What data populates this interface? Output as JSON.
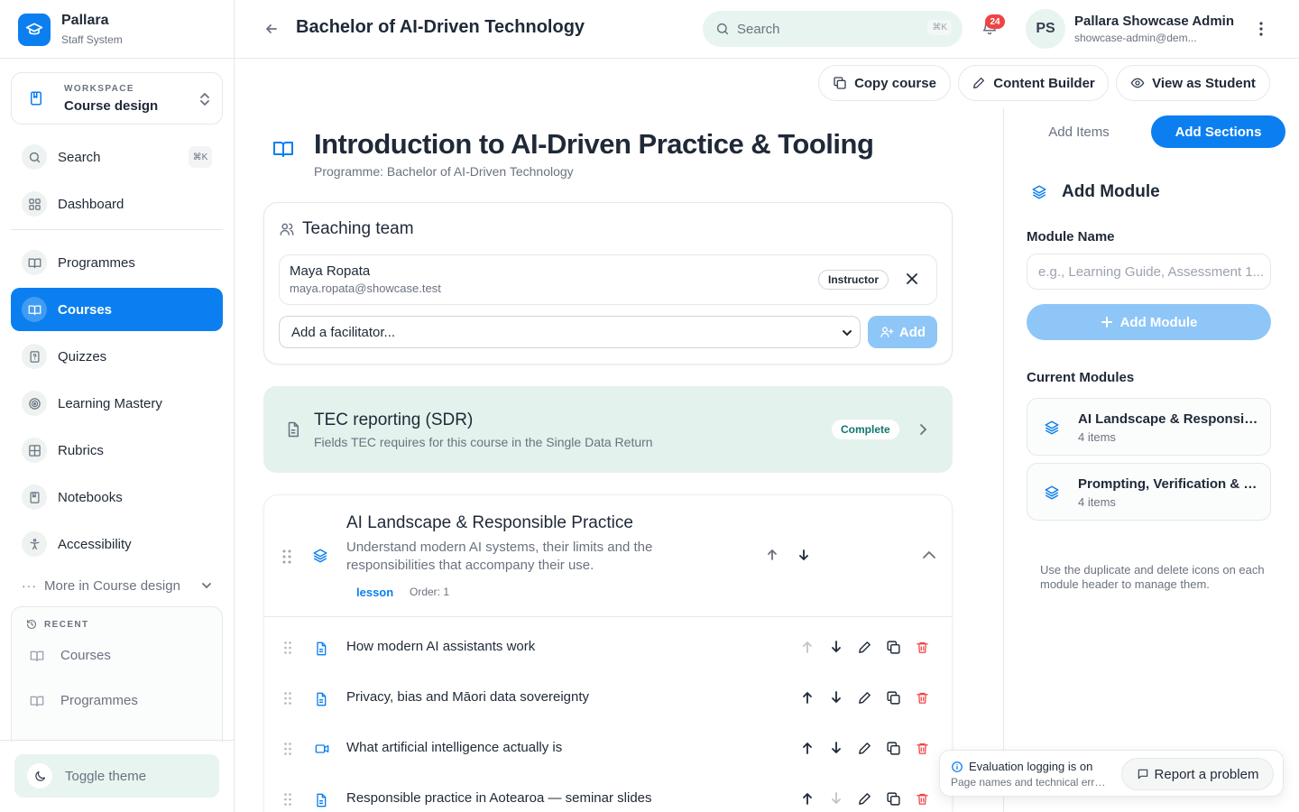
{
  "brand": {
    "name": "Pallara",
    "subtitle": "Staff System"
  },
  "workspace": {
    "label": "WORKSPACE",
    "value": "Course design"
  },
  "nav": {
    "search": {
      "label": "Search",
      "shortcut": "⌘K"
    },
    "dashboard": "Dashboard",
    "items": [
      "Programmes",
      "Courses",
      "Quizzes",
      "Learning Mastery",
      "Rubrics",
      "Notebooks",
      "Accessibility"
    ],
    "active": "Courses",
    "more": "More in Course design"
  },
  "recent": {
    "title": "RECENT",
    "items": [
      "Courses",
      "Programmes"
    ]
  },
  "toggle_theme": "Toggle theme",
  "header": {
    "title": "Bachelor of AI-Driven Technology",
    "search_placeholder": "Search",
    "search_shortcut": "⌘K",
    "notification_count": "24",
    "user": {
      "initials": "PS",
      "name": "Pallara Showcase Admin",
      "email": "showcase-admin@dem..."
    }
  },
  "toolbar": {
    "copy": "Copy course",
    "builder": "Content Builder",
    "student": "View as Student"
  },
  "course": {
    "title": "Introduction to AI-Driven Practice & Tooling",
    "programme": "Programme: Bachelor of AI-Driven Technology"
  },
  "teaching_team": {
    "title": "Teaching team",
    "member": {
      "name": "Maya Ropata",
      "email": "maya.ropata@showcase.test",
      "role": "Instructor"
    },
    "facilitator_placeholder": "Add a facilitator...",
    "add_label": "Add"
  },
  "tec": {
    "title": "TEC reporting (SDR)",
    "subtitle": "Fields TEC requires for this course in the Single Data Return",
    "status": "Complete"
  },
  "module": {
    "title": "AI Landscape & Responsible Practice",
    "description": "Understand modern AI systems, their limits and the responsibilities that accompany their use.",
    "type": "lesson",
    "order": "Order: 1",
    "items": [
      {
        "label": "How modern AI assistants work",
        "kind": "document-icon"
      },
      {
        "label": "Privacy, bias and Māori data sovereignty",
        "kind": "document-icon"
      },
      {
        "label": "What artificial intelligence actually is",
        "kind": "video-icon"
      },
      {
        "label": "Responsible practice in Aotearoa — seminar slides",
        "kind": "document-icon"
      }
    ]
  },
  "right_panel": {
    "tabs": [
      "Add Items",
      "Add Sections"
    ],
    "active_tab": "Add Sections",
    "heading": "Add Module",
    "name_label": "Module Name",
    "name_placeholder": "e.g., Learning Guide, Assessment 1...",
    "add_button": "Add Module",
    "current_label": "Current Modules",
    "modules": [
      {
        "title": "AI Landscape & Responsible Practice",
        "count": "4 items"
      },
      {
        "title": "Prompting, Verification & Practice",
        "count": "4 items"
      }
    ],
    "hint": "Use the duplicate and delete icons on each module header to manage them."
  },
  "eval_toast": {
    "title": "Evaluation logging is on",
    "subtitle": "Page names and technical errors",
    "report": "Report a problem"
  },
  "colors": {
    "accent": "#0b7ff0",
    "accent_light": "#8ec6f8",
    "mint": "#e3f2ec",
    "danger": "#ef4444"
  }
}
